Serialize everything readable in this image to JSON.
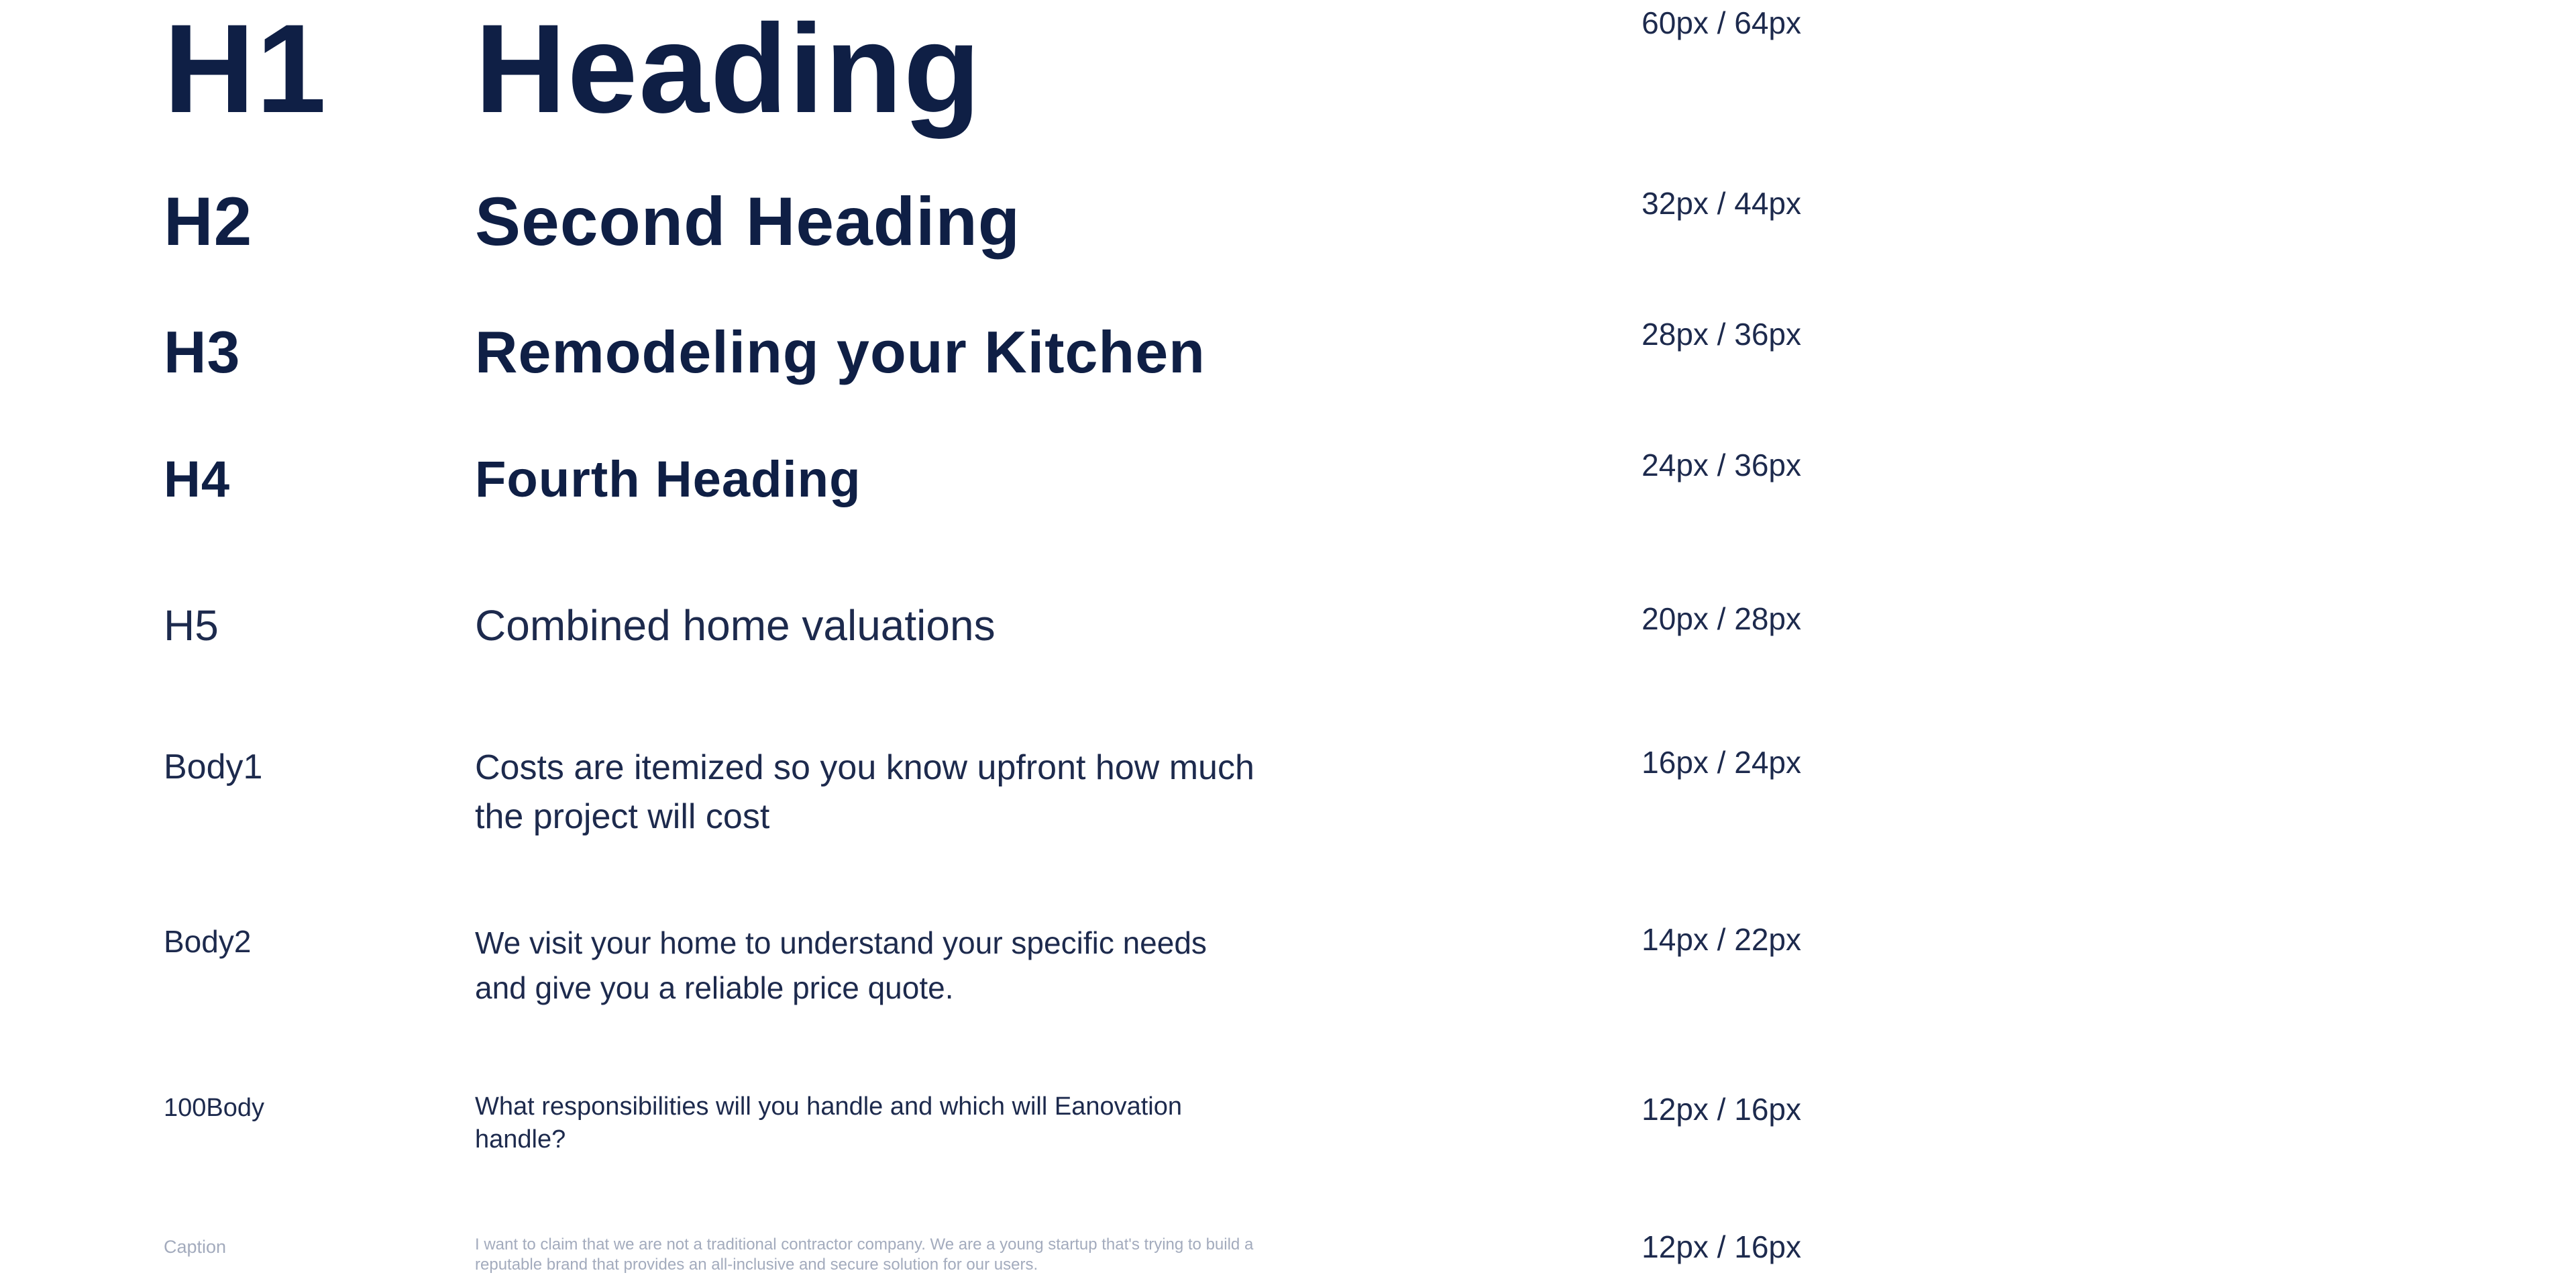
{
  "type_scale": [
    {
      "id": "h1",
      "label": "H1",
      "sample": "Heading",
      "spec": "60px / 64px"
    },
    {
      "id": "h2",
      "label": "H2",
      "sample": "Second Heading",
      "spec": "32px / 44px"
    },
    {
      "id": "h3",
      "label": "H3",
      "sample": "Remodeling your Kitchen",
      "spec": "28px / 36px"
    },
    {
      "id": "h4",
      "label": "H4",
      "sample": "Fourth Heading",
      "spec": "24px / 36px"
    },
    {
      "id": "h5",
      "label": "H5",
      "sample": "Combined home valuations",
      "spec": "20px / 28px"
    },
    {
      "id": "body1",
      "label": "Body1",
      "sample": "Costs are itemized so you know upfront how much the project will cost",
      "spec": "16px / 24px"
    },
    {
      "id": "body2",
      "label": "Body2",
      "sample": "We visit your home to understand your specific needs and give you a reliable price quote.",
      "spec": "14px / 22px"
    },
    {
      "id": "body100",
      "label": "100Body",
      "sample": "What responsibilities will you handle and which will Eanovation handle?",
      "spec": "12px / 16px"
    },
    {
      "id": "caption",
      "label": "Caption",
      "sample": "I want to claim that we are not a traditional contractor company. We are a young startup that's trying to build a reputable brand that provides an all-inclusive and secure solution for our users.",
      "spec": "12px / 16px"
    }
  ],
  "colors": {
    "heading": "#0f1f45",
    "body": "#1d2a4d",
    "caption": "#a3abbd",
    "background": "#ffffff"
  }
}
